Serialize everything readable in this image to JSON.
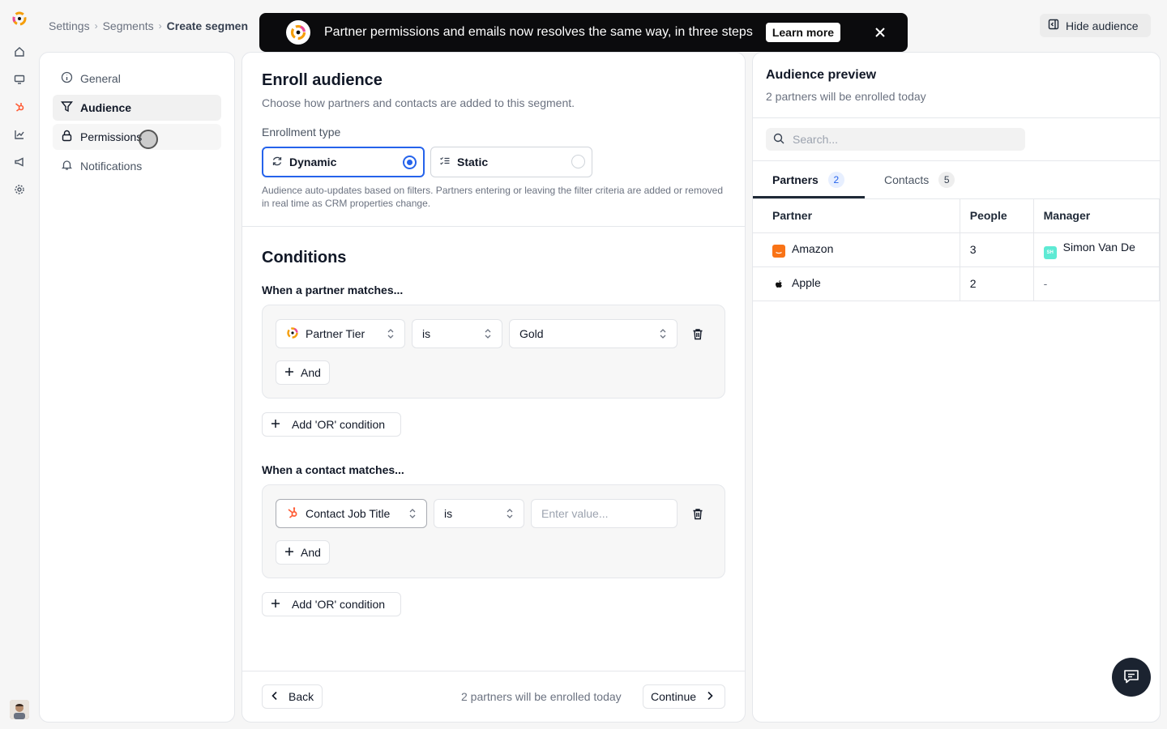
{
  "breadcrumb": {
    "items": [
      "Settings",
      "Segments"
    ],
    "current": "Create segmen"
  },
  "header": {
    "hide_audience": "Hide audience"
  },
  "toast": {
    "message": "Partner permissions and emails now resolves the same way, in three steps",
    "cta": "Learn more"
  },
  "left_nav": [
    {
      "label": "General",
      "icon": "info-icon"
    },
    {
      "label": "Audience",
      "icon": "filter-icon"
    },
    {
      "label": "Permissions",
      "icon": "lock-icon"
    },
    {
      "label": "Notifications",
      "icon": "bell-icon"
    }
  ],
  "enroll": {
    "title": "Enroll audience",
    "subtitle": "Choose how partners and contacts are added to this segment.",
    "type_label": "Enrollment type",
    "options": [
      "Dynamic",
      "Static"
    ],
    "selected": "Dynamic",
    "help": "Audience auto-updates based on filters. Partners entering or leaving the filter criteria are added or removed in real time as CRM properties change."
  },
  "conditions": {
    "title": "Conditions",
    "partner_label": "When a partner matches...",
    "partner_rule": {
      "property": "Partner Tier",
      "operator": "is",
      "value": "Gold"
    },
    "contact_label": "When a contact matches...",
    "contact_rule": {
      "property": "Contact Job Title",
      "operator": "is",
      "value_placeholder": "Enter value..."
    },
    "and_label": "And",
    "or_label": "Add 'OR' condition"
  },
  "footer": {
    "back": "Back",
    "note": "2 partners will be enrolled today",
    "continue": "Continue"
  },
  "preview": {
    "title": "Audience preview",
    "subtitle": "2 partners will be enrolled today",
    "search_placeholder": "Search...",
    "tabs": [
      {
        "label": "Partners",
        "count": "2"
      },
      {
        "label": "Contacts",
        "count": "5"
      }
    ],
    "columns": [
      "Partner",
      "People",
      "Manager"
    ],
    "rows": [
      {
        "partner": "Amazon",
        "people": "3",
        "manager": "Simon Van De",
        "manager_initials": "SH"
      },
      {
        "partner": "Apple",
        "people": "2",
        "manager": "-"
      }
    ]
  },
  "colors": {
    "accent": "#2563eb",
    "hubspot": "#ff5c35",
    "amazon": "#f97316",
    "toast_bg": "#0b0b0d"
  }
}
